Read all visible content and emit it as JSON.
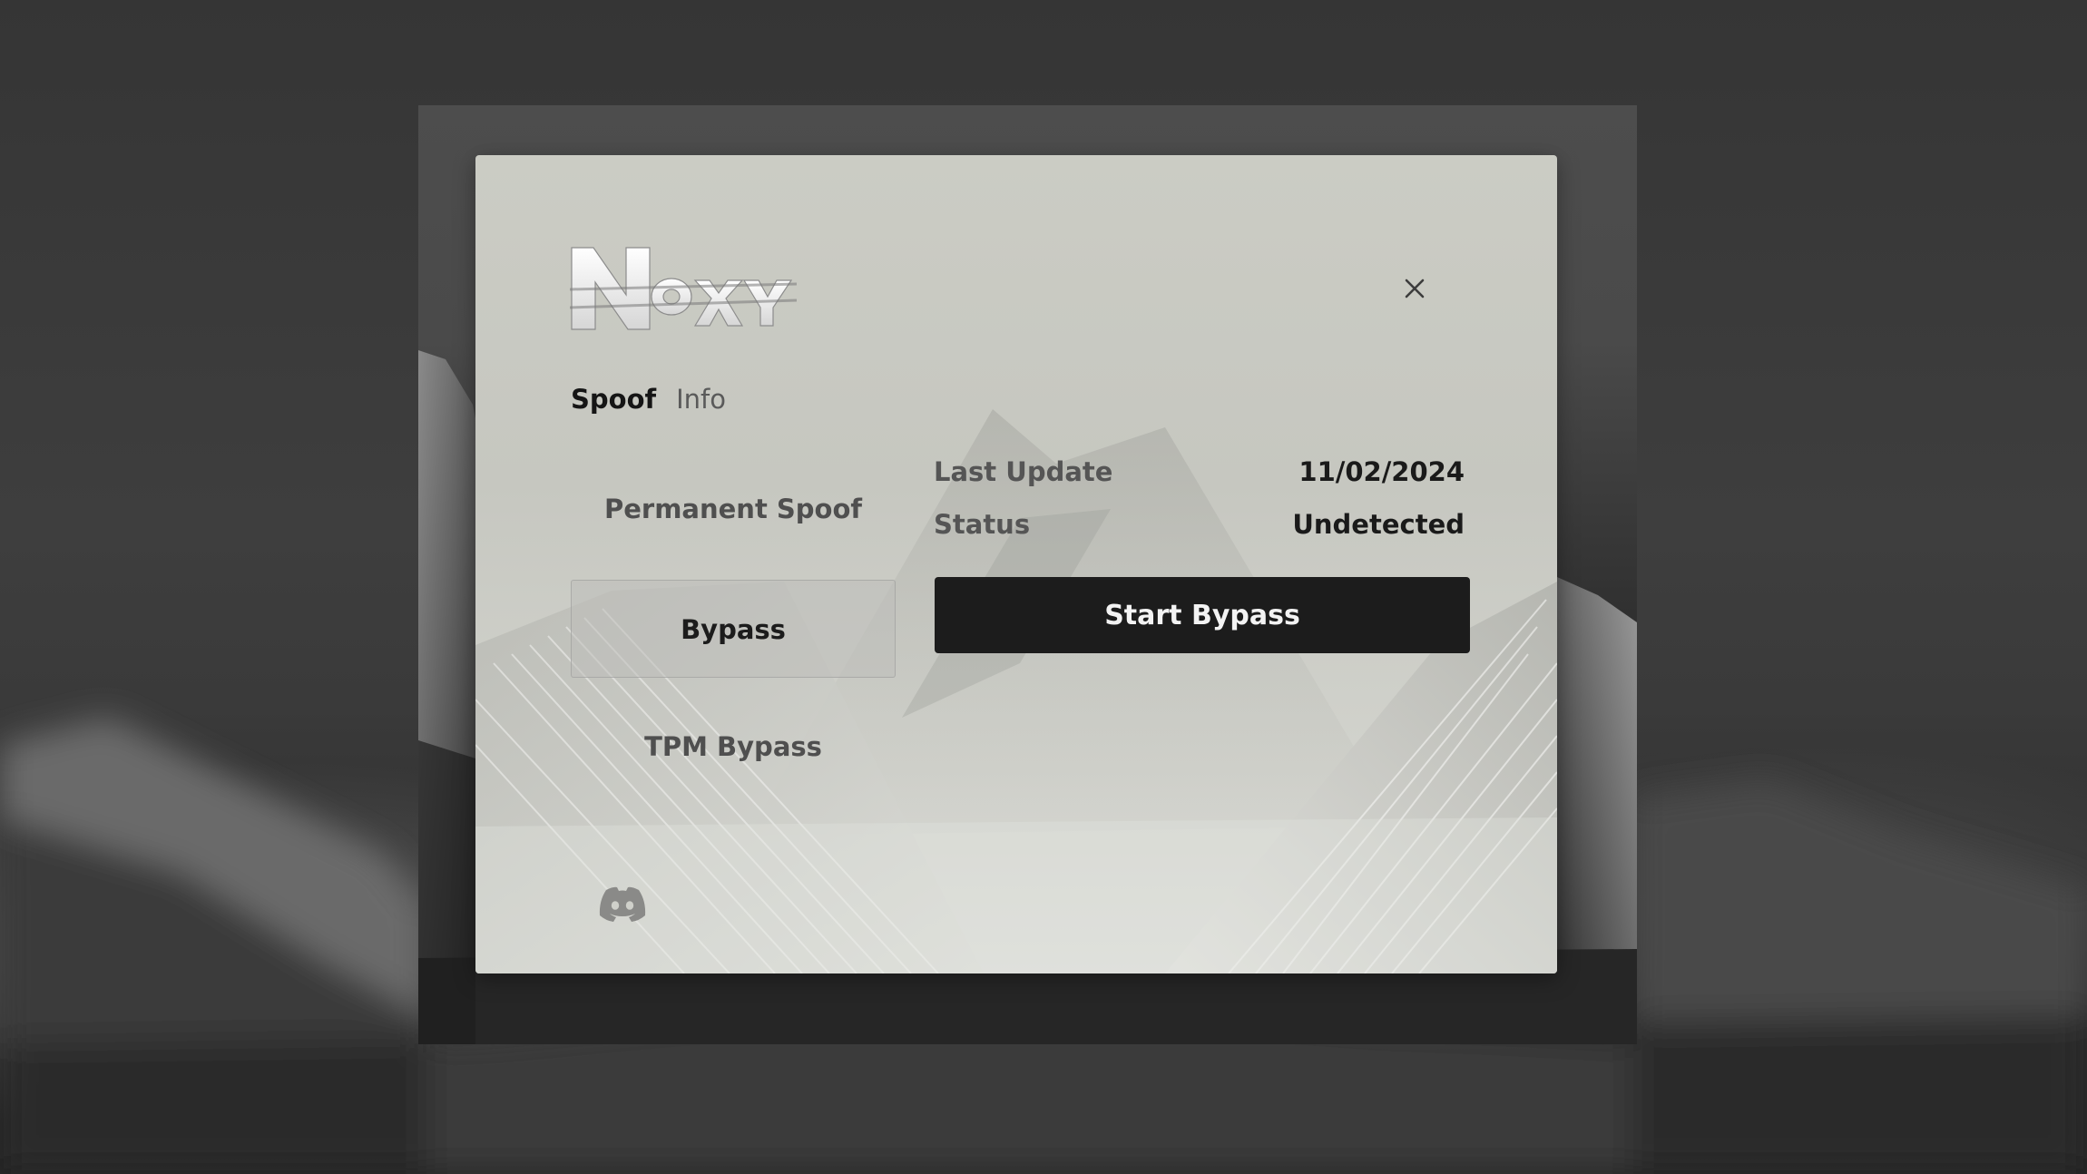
{
  "app": {
    "logo_text": "NOXY"
  },
  "tabs": [
    {
      "label": "Spoof",
      "active": true
    },
    {
      "label": "Info",
      "active": false
    }
  ],
  "nav": {
    "permanent_spoof": "Permanent Spoof",
    "bypass": "Bypass",
    "tpm_bypass": "TPM Bypass",
    "selected": "Bypass"
  },
  "info": {
    "last_update_label": "Last Update",
    "last_update_value": "11/02/2024",
    "status_label": "Status",
    "status_value": "Undetected"
  },
  "actions": {
    "start_bypass": "Start Bypass"
  },
  "icons": {
    "close": "close-icon",
    "discord": "discord-icon"
  },
  "colors": {
    "primary_button": "#1c1c1c",
    "window_bg": "#cbccc4",
    "text_dark": "#151515",
    "text_muted": "#5a5a5a"
  }
}
